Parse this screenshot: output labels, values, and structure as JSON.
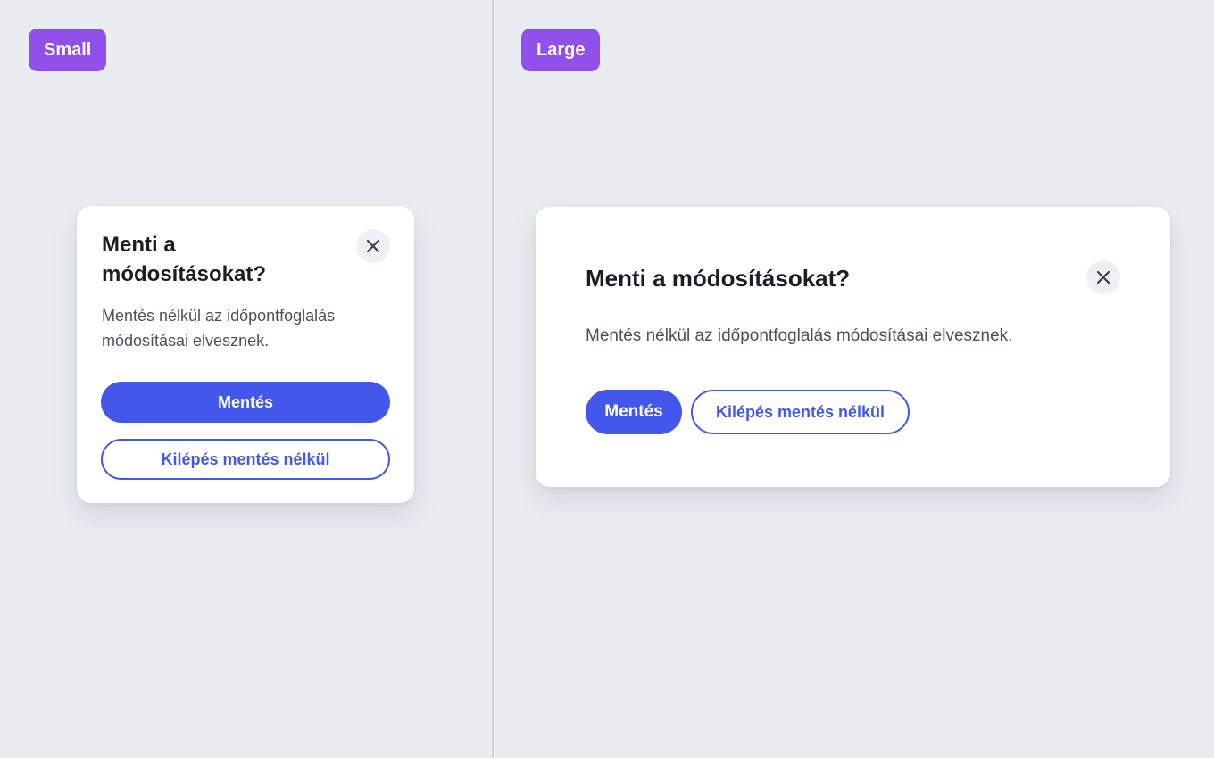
{
  "colors": {
    "background": "#e9ecf1",
    "badge": "#9050e9",
    "primary": "#4357ea",
    "title_text": "#1a1d24",
    "body_text": "#4a5060",
    "close_button_bg": "#eef0f3"
  },
  "small": {
    "badge_label": "Small",
    "dialog": {
      "title": "Menti a módosításokat?",
      "message": "Mentés nélkül az időpontfoglalás módosításai elvesznek.",
      "save_label": "Mentés",
      "discard_label": "Kilépés mentés nélkül",
      "close_icon": "close-icon"
    }
  },
  "large": {
    "badge_label": "Large",
    "dialog": {
      "title": "Menti a módosításokat?",
      "message": "Mentés nélkül az időpontfoglalás módosításai elvesznek.",
      "save_label": "Mentés",
      "discard_label": "Kilépés mentés nélkül",
      "close_icon": "close-icon"
    }
  }
}
